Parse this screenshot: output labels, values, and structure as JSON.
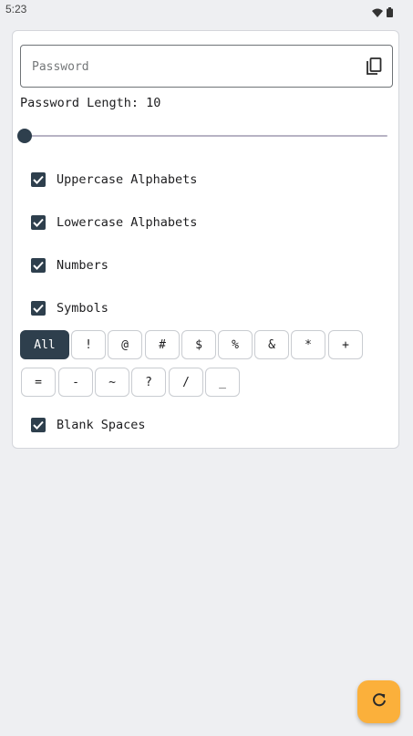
{
  "status_bar": {
    "time": "5:23",
    "icons": [
      "wifi-icon",
      "battery-icon"
    ]
  },
  "password_field": {
    "placeholder": "Password",
    "value": "",
    "copy_icon": "copy-icon"
  },
  "length": {
    "label": "Password Length: 10",
    "value": 10,
    "min": 10,
    "max": 100
  },
  "options": [
    {
      "label": "Uppercase Alphabets",
      "checked": true
    },
    {
      "label": "Lowercase Alphabets",
      "checked": true
    },
    {
      "label": "Numbers",
      "checked": true
    },
    {
      "label": "Symbols",
      "checked": true
    }
  ],
  "symbols": {
    "chips": [
      "All",
      "!",
      "@",
      "#",
      "$",
      "%",
      "&",
      "*",
      "+",
      "=",
      "-",
      "~",
      "?",
      "/",
      "_"
    ],
    "selected": "All"
  },
  "blank_spaces": {
    "label": "Blank Spaces",
    "checked": true
  },
  "fab": {
    "icon": "refresh-icon"
  },
  "colors": {
    "accent": "#2e3f4d",
    "fab": "#fbb03b",
    "background": "#eeeff2"
  }
}
